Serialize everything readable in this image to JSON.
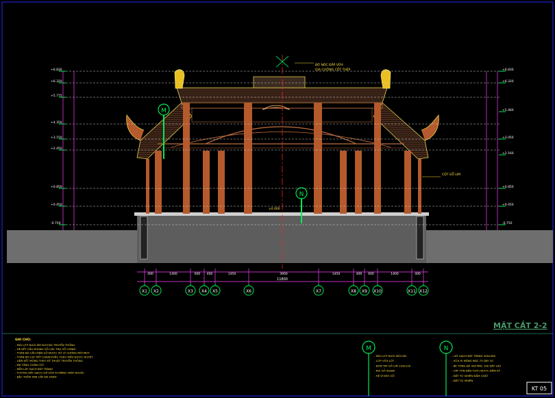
{
  "section_title": "MẶT CẮT 2-2",
  "sheet_id": "KT 05",
  "axes": [
    "X1",
    "X2",
    "X3",
    "X4",
    "X5",
    "X6",
    "X7",
    "X8",
    "X9",
    "X10",
    "X11",
    "X12"
  ],
  "markers": {
    "m": "M",
    "n": "N"
  },
  "notes_heading": "GHI CHÚ:",
  "notes_lines": [
    "- MÁI LỢP NGÓI ÂM DƯƠNG TRUYỀN THỐNG",
    "- HỆ KẾT CẤU KHUNG GỖ LIM, TRỤ GỖ CHÍNH",
    "- TOÀN BỘ CẤU KIỆN GỖ ĐƯỢC XỬ LÝ CHỐNG MỐI MỌT",
    "- TOÀN BỘ CHI TIẾT CHẠM KHẮC THEO MẪU ĐƯỢC DUYỆT",
    "- LIÊN KẾT MỘNG THEO KỸ THUẬT TRUYỀN THỐNG",
    "- ĐÁ TẢNG CHÂN CỘT",
    "- NỀN LÁT GẠCH BÁT TRÀNG",
    "- TƯỜNG XÂY GẠCH CHỈ VỮA XI MĂNG TRÁT NGOÀI",
    "- BẬC THỀM TAM CẤP ĐÁ XANH"
  ],
  "legend_m": [
    "- MÁI LỢP NGÓI MŨI HÀI",
    "- LỚP VỮA LÓT",
    "- ĐÒN TAY GỖ LIM 120x120",
    "- RUI GỖ 40x60",
    "- HỆ VÌ KÈO GỖ"
  ],
  "legend_n": [
    "- LÁT GẠCH BÁT TRÀNG 300x300",
    "- VỮA XI MĂNG MÁC 75 DÀY 20",
    "- BÊ TÔNG ĐÁ 4x6 MÁC 100 DÀY 100",
    "- CÁT TÔN NỀN TƯỚI NƯỚC ĐẦM KỸ",
    "- ĐẤT TỰ NHIÊN ĐẦM CHẶT",
    "- ĐẤT TỰ NHIÊN"
  ],
  "ridge_note": [
    "BỜ NÓC ĐẮP VỮA",
    "GIA CƯỜNG CỐT THÉP"
  ],
  "right_callout": "CỘT GỖ LIM",
  "floor_label": "±0.000",
  "level_labels_left": [
    "+6.830",
    "+6.320",
    "+5.775",
    "+4.350",
    "+3.150",
    "+2.450",
    "+0.850",
    "+0.450",
    "-0.750"
  ],
  "level_labels_right": [
    "+6.830",
    "+6.320",
    "+5.460",
    "+3.050",
    "+2.160",
    "+0.850",
    "+0.450",
    "-0.750"
  ],
  "dims_bottom": [
    "400",
    "1400",
    "600",
    "400",
    "1450",
    "3900",
    "1450",
    "400",
    "600",
    "1400",
    "400"
  ],
  "dim_total": "11800",
  "colors": {
    "bg": "#000000",
    "frame": "#1a1aa8",
    "accent": "#00cc55",
    "wood": "#b55a2c",
    "ground": "#6e6e6e",
    "yellow": "#ffe040",
    "axis": "#ff2020",
    "dim": "#ff40ff"
  }
}
